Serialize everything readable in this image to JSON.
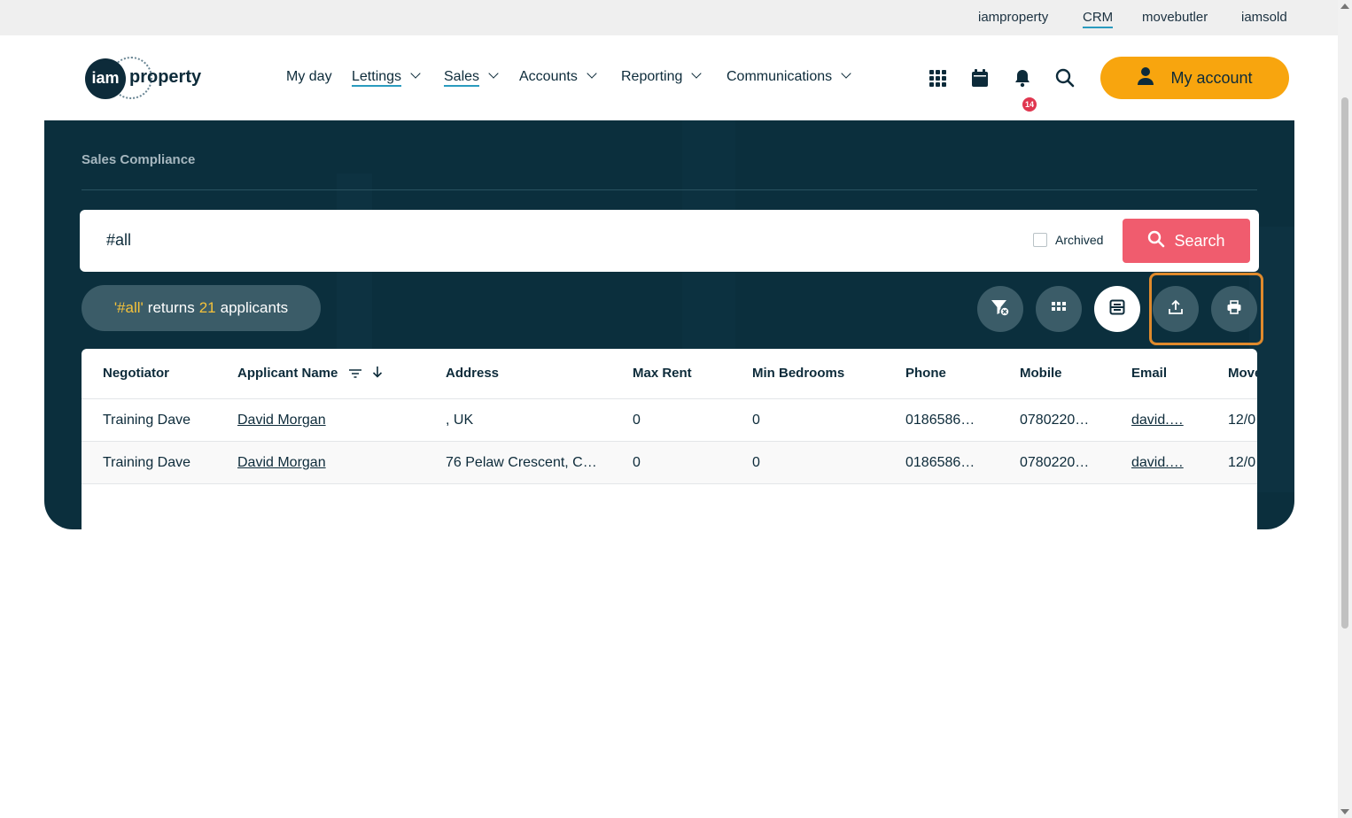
{
  "topbar": {
    "links": [
      {
        "label": "iamproperty",
        "active": false
      },
      {
        "label": "CRM",
        "active": true
      },
      {
        "label": "movebutler",
        "active": false
      },
      {
        "label": "iamsold",
        "active": false
      }
    ]
  },
  "header": {
    "logo": {
      "mark": "iam",
      "word": "property"
    },
    "nav": [
      {
        "label": "My day",
        "dropdown": false,
        "underlined": false
      },
      {
        "label": "Lettings",
        "dropdown": true,
        "underlined": true
      },
      {
        "label": "Sales",
        "dropdown": true,
        "underlined": true
      },
      {
        "label": "Accounts",
        "dropdown": true,
        "underlined": false
      },
      {
        "label": "Reporting",
        "dropdown": true,
        "underlined": false
      },
      {
        "label": "Communications",
        "dropdown": true,
        "underlined": false
      }
    ],
    "icons": [
      "apps-grid-icon",
      "calendar-icon",
      "bell-icon",
      "search-icon"
    ],
    "notifications_count": "14",
    "account_label": "My account"
  },
  "page": {
    "breadcrumb": "Sales Compliance",
    "search": {
      "query": "#all",
      "archived_label": "Archived",
      "archived_checked": false,
      "button_label": "Search"
    },
    "results": {
      "prefix": "'#all'",
      "word_returns": "returns",
      "count": "21",
      "suffix": "applicants"
    },
    "toolbar_icons": [
      "clear-filter-icon",
      "grid-view-icon",
      "card-view-icon",
      "export-icon",
      "print-icon"
    ]
  },
  "table": {
    "columns": [
      "Negotiator",
      "Applicant Name",
      "Address",
      "Max Rent",
      "Min Bedrooms",
      "Phone",
      "Mobile",
      "Email",
      "Move"
    ],
    "rows": [
      [
        "Training Dave",
        "David Morgan",
        ", UK",
        "0",
        "0",
        "0186586…",
        "0780220…",
        "david.…",
        "12/0"
      ],
      [
        "Training Dave",
        "David Morgan",
        "76 Pelaw Crescent, C…",
        "0",
        "0",
        "0186586…",
        "0780220…",
        "david.…",
        "12/0"
      ]
    ]
  },
  "colors": {
    "brand_dark": "#0b2f3d",
    "accent_orange": "#f8a50e",
    "search_red": "#f05c6e",
    "highlight_yellow": "#f5c23a",
    "focus_outline": "#e08a2c"
  }
}
